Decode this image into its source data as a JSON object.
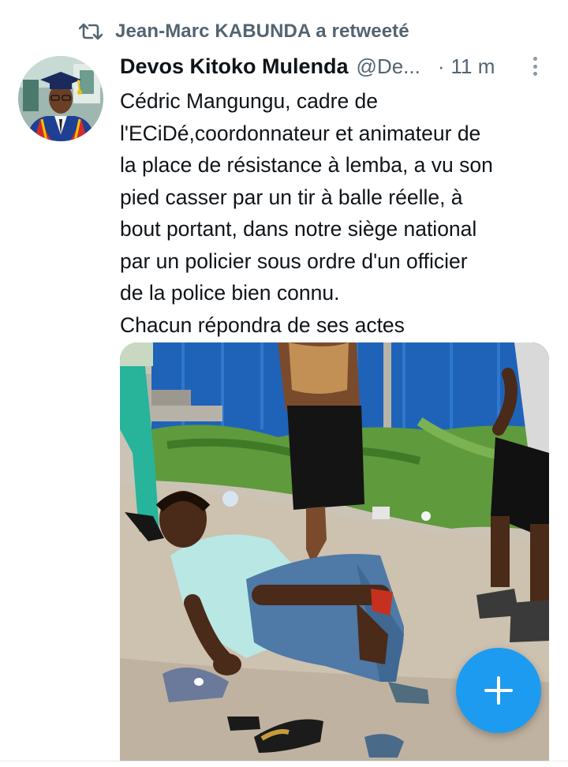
{
  "retweet": {
    "icon": "retweet-icon",
    "text": "Jean-Marc KABUNDA a retweeté"
  },
  "tweet": {
    "author_name": "Devos Kitoko Mulenda",
    "author_handle": "@De...",
    "separator": "·",
    "time": "11 m",
    "text": "Cédric Mangungu, cadre de\nl'ECiDé,coordonnateur et animateur de\nla place de résistance à lemba, a vu son\npied casser par un tir à balle réelle, à\nbout portant, dans notre siège national\npar un policier sous ordre d'un officier\nde la police bien connu.\nChacun répondra de ses actes"
  },
  "compose_button": {
    "icon": "plus-icon",
    "color": "#1d9bf0"
  },
  "colors": {
    "secondary_text": "#536471",
    "primary_text": "#0f1419",
    "accent": "#1d9bf0"
  }
}
